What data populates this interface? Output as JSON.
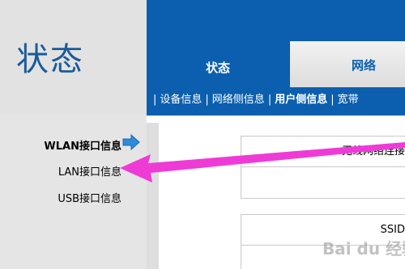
{
  "page": {
    "title": "状态"
  },
  "header": {
    "tabs": [
      {
        "label": "状态",
        "active": true
      },
      {
        "label": "网络",
        "active": false
      }
    ],
    "subnav": [
      {
        "label": "设备信息"
      },
      {
        "label": "网络侧信息"
      },
      {
        "label": "用户侧信息",
        "active": true
      },
      {
        "label": "宽带"
      }
    ],
    "separator": "|"
  },
  "sidebar": {
    "items": [
      {
        "label": "WLAN接口信息",
        "active": true
      },
      {
        "label": "LAN接口信息"
      },
      {
        "label": "USB接口信息"
      }
    ]
  },
  "content": {
    "section_title": "无线网络连接",
    "ssid_label": "SSID"
  },
  "watermark": {
    "text": "Bai du 经验"
  },
  "colors": {
    "header_blue": "#0b5fae",
    "title_blue": "#1a5a9a",
    "annotation_pink": "#ee3bd6",
    "arrow_blue": "#2e8bd8"
  }
}
